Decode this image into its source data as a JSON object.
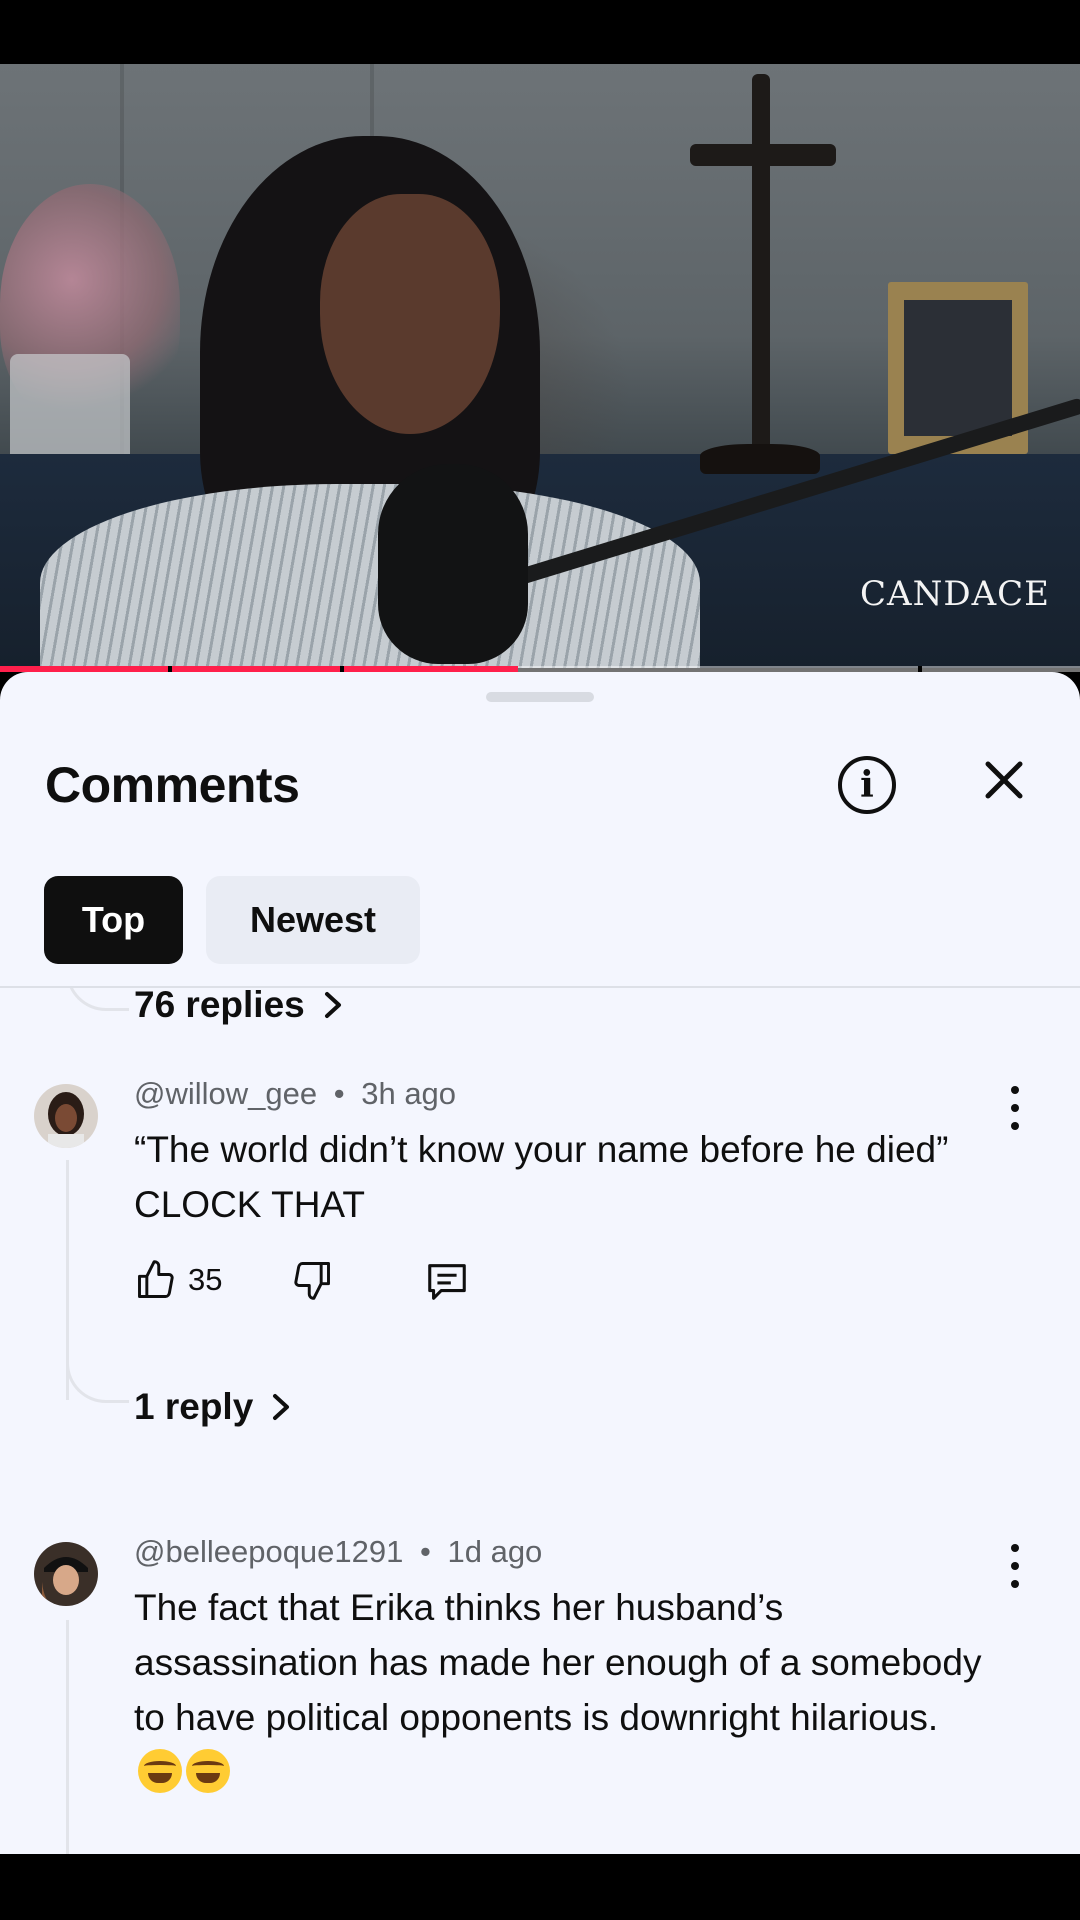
{
  "video": {
    "watermark": "CANDACE",
    "progress_percent": 48
  },
  "comments_panel": {
    "title": "Comments",
    "info_icon": "info-icon",
    "close_icon": "close-icon",
    "tabs": [
      {
        "label": "Top",
        "selected": true
      },
      {
        "label": "Newest",
        "selected": false
      }
    ],
    "accent_color": "#ff1f4b"
  },
  "comments": [
    {
      "replies_label": "76 replies"
    },
    {
      "author": "@willow_gee",
      "separator": "•",
      "time": "3h ago",
      "text": "“The world didn’t know your name before he died” CLOCK THAT",
      "likes": "35",
      "replies_label": "1 reply"
    },
    {
      "author": "@belleepoque1291",
      "separator": "•",
      "time": "1d ago",
      "text": "The fact that Erika thinks her husband’s assassination has made her enough of a somebody to have political opponents is downright hilarious."
    }
  ]
}
